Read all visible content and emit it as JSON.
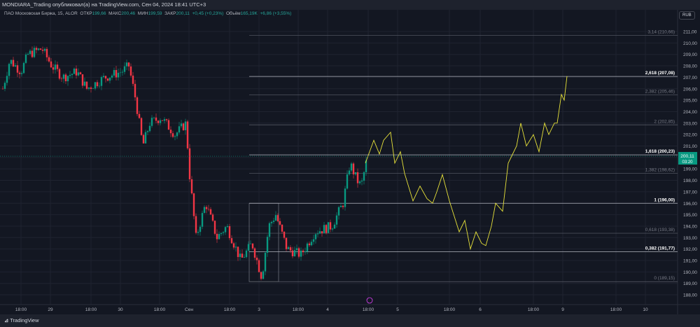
{
  "header": {
    "title": "MONDIARA_Trading опубликовал(а) на TradingView.com, Сен 04, 2024 18:41 UTC+3"
  },
  "legend": {
    "symbol": "ПАО Московская Биржа, 15, ALOR",
    "open_label": "ОТКР",
    "open": "199,66",
    "high_label": "МАКС",
    "high": "200,46",
    "low_label": "МИН",
    "low": "199,59",
    "close_label": "ЗАКР",
    "close": "200,11",
    "change": "+0,45 (+0,23%)",
    "volume_label": "Объём",
    "volume": "165,19K",
    "volume_change": "+6,86 (+3,55%)"
  },
  "currency": "RUB",
  "footer": {
    "brand": "TradingView"
  },
  "price_badge": {
    "price": "200,11",
    "countdown": "03:20",
    "color": "#089981"
  },
  "chart_data": {
    "type": "candlestick",
    "yrange": [
      187.5,
      211.5
    ],
    "y_ticks": [
      211,
      210,
      209,
      208,
      207,
      206,
      205,
      204,
      203,
      202,
      201,
      200,
      199,
      198,
      197,
      196,
      195,
      194,
      193,
      192,
      191,
      190,
      189,
      188
    ],
    "y_tick_labels": [
      "211,00",
      "210,00",
      "209,00",
      "208,00",
      "207,00",
      "206,00",
      "205,00",
      "204,00",
      "203,00",
      "202,00",
      "201,00",
      "200,00",
      "199,00",
      "198,00",
      "197,00",
      "196,00",
      "195,00",
      "194,00",
      "193,00",
      "192,00",
      "191,00",
      "190,00",
      "189,00",
      "188,00"
    ],
    "x_ticks": [
      {
        "bar": 15,
        "label": "18:00"
      },
      {
        "bar": 36,
        "label": "29"
      },
      {
        "bar": 65,
        "label": "18:00"
      },
      {
        "bar": 86,
        "label": "30"
      },
      {
        "bar": 114,
        "label": "18:00"
      },
      {
        "bar": 135,
        "label": "Сен"
      },
      {
        "bar": 164,
        "label": "18:00"
      },
      {
        "bar": 185,
        "label": "3"
      },
      {
        "bar": 213,
        "label": "18:00"
      },
      {
        "bar": 234,
        "label": "4"
      },
      {
        "bar": 263,
        "label": "18:00"
      },
      {
        "bar": 284,
        "label": "5"
      },
      {
        "bar": 321,
        "label": "18:00"
      },
      {
        "bar": 343,
        "label": "6"
      },
      {
        "bar": 381,
        "label": "18:00"
      },
      {
        "bar": 402,
        "label": "9"
      },
      {
        "bar": 440,
        "label": "18:00"
      },
      {
        "bar": 461,
        "label": "10"
      }
    ],
    "price_path_anchors": [
      [
        2,
        206
      ],
      [
        7,
        208.5
      ],
      [
        15,
        207.5
      ],
      [
        20,
        209
      ],
      [
        30,
        209.5
      ],
      [
        37,
        208
      ],
      [
        45,
        207
      ],
      [
        55,
        207.5
      ],
      [
        62,
        206
      ],
      [
        75,
        207
      ],
      [
        87,
        207.5
      ],
      [
        92,
        208
      ],
      [
        97,
        205
      ],
      [
        102,
        201
      ],
      [
        107,
        203
      ],
      [
        115,
        203.5
      ],
      [
        125,
        202
      ],
      [
        133,
        203
      ],
      [
        135,
        199
      ],
      [
        140,
        193
      ],
      [
        147,
        196
      ],
      [
        155,
        193
      ],
      [
        162,
        194
      ],
      [
        172,
        191
      ],
      [
        180,
        192.5
      ],
      [
        187,
        189.5
      ],
      [
        192,
        194
      ],
      [
        197,
        195
      ],
      [
        205,
        192
      ],
      [
        215,
        191.5
      ],
      [
        225,
        193.5
      ],
      [
        237,
        194
      ],
      [
        245,
        196
      ],
      [
        250,
        199.5
      ],
      [
        255,
        198
      ],
      [
        258,
        197.5
      ],
      [
        262,
        199.8
      ]
    ],
    "projection": {
      "color": "#e8e33a",
      "points": [
        [
          261,
          199.5
        ],
        [
          267,
          201.5
        ],
        [
          271,
          200.3
        ],
        [
          274,
          201.5
        ],
        [
          279,
          202.2
        ],
        [
          282,
          199.5
        ],
        [
          286,
          200.5
        ],
        [
          289,
          198.6
        ],
        [
          295,
          196.2
        ],
        [
          300,
          197.5
        ],
        [
          305,
          196.4
        ],
        [
          309,
          196
        ],
        [
          312,
          197
        ],
        [
          316,
          198.5
        ],
        [
          321,
          196.2
        ],
        [
          328,
          193.5
        ],
        [
          332,
          194.5
        ],
        [
          336,
          192
        ],
        [
          340,
          193.5
        ],
        [
          344,
          192.5
        ],
        [
          347,
          192.3
        ],
        [
          351,
          194
        ],
        [
          354,
          196
        ],
        [
          359,
          195.3
        ],
        [
          363,
          199.5
        ],
        [
          369,
          201
        ],
        [
          372,
          203
        ],
        [
          376,
          201
        ],
        [
          381,
          202
        ],
        [
          385,
          200.5
        ],
        [
          389,
          203
        ],
        [
          392,
          202
        ],
        [
          396,
          203
        ],
        [
          398,
          203
        ],
        [
          401,
          205.5
        ],
        [
          403,
          205
        ],
        [
          405,
          207.1
        ]
      ]
    },
    "fib": {
      "start_bar": 178,
      "box_end_bar": 199,
      "end_bar": 484,
      "levels": [
        {
          "value": 189.15,
          "label": "0 (189,15)",
          "bold": false
        },
        {
          "value": 191.77,
          "label": "0,382 (191,77)",
          "bold": true
        },
        {
          "value": 193.38,
          "label": "0,618 (193,38)",
          "bold": false
        },
        {
          "value": 196.0,
          "label": "1 (196,00)",
          "bold": true
        },
        {
          "value": 198.62,
          "label": "1,382 (198,62)",
          "bold": false
        },
        {
          "value": 200.23,
          "label": "1,618 (200,23)",
          "bold": true
        },
        {
          "value": 202.85,
          "label": "2 (202,85)",
          "bold": false
        },
        {
          "value": 205.46,
          "label": "2,382 (205,46)",
          "bold": false
        },
        {
          "value": 207.08,
          "label": "2,618 (207,08)",
          "bold": true
        },
        {
          "value": 210.66,
          "label": "3,14 (210,66)",
          "bold": false
        }
      ]
    }
  }
}
